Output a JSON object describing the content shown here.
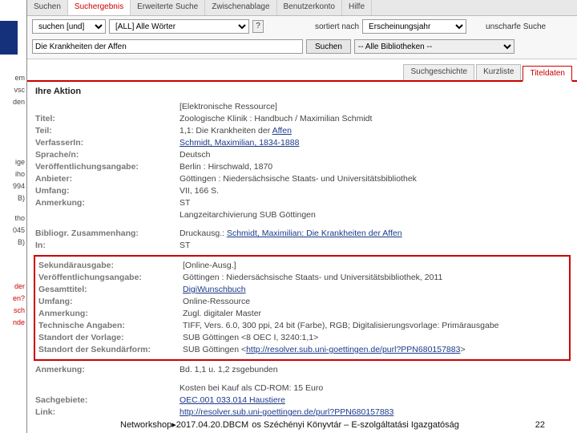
{
  "left": {
    "items": [
      "em",
      "vsc",
      "den",
      "",
      "ige",
      "iho",
      "994",
      "B)",
      "",
      "tho",
      "045",
      "B)"
    ],
    "red_items": [
      "der",
      "en?",
      "sch",
      "nde"
    ]
  },
  "topnav": {
    "tabs": [
      "Suchen",
      "Suchergebnis",
      "Erweiterte Suche",
      "Zwischenablage",
      "Benutzerkonto",
      "Hilfe"
    ],
    "active_index": 1
  },
  "search": {
    "mode": "suchen [und]",
    "field": "[ALL] Alle Wörter",
    "help": "?",
    "sort_label": "sortiert nach",
    "sort_value": "Erscheinungsjahr",
    "fuzzy_label": "unscharfe Suche",
    "query": "Die Krankheiten der Affen",
    "submit": "Suchen",
    "lib": "-- Alle Bibliotheken --"
  },
  "resulttabs": {
    "tabs": [
      "Suchgeschichte",
      "Kurzliste",
      "Titeldaten"
    ],
    "active_index": 2
  },
  "aktion_label": "Ihre Aktion",
  "block1": [
    {
      "label": "",
      "value": "[Elektronische Ressource]"
    },
    {
      "label": "Titel:",
      "value": "Zoologische Klinik : Handbuch / Maximilian Schmidt"
    },
    {
      "label": "Teil:",
      "value_html": "1,1: Die Krankheiten der <a href='#'>Affen</a>"
    },
    {
      "label": "VerfasserIn:",
      "value_html": "<a href='#'>Schmidt, Maximilian, 1834-1888</a>"
    },
    {
      "label": "Sprache/n:",
      "value": "Deutsch"
    },
    {
      "label": "Veröffentlichungsangabe:",
      "value": "Berlin : Hirschwald, 1870"
    },
    {
      "label": "Anbieter:",
      "value": "Göttingen : Niedersächsische Staats- und Universitätsbibliothek"
    },
    {
      "label": "Umfang:",
      "value": "VII, 166 S."
    },
    {
      "label": "Anmerkung:",
      "value": "ST"
    },
    {
      "label": "",
      "value": "Langzeitarchivierung SUB Göttingen"
    }
  ],
  "block2": [
    {
      "label": "Bibliogr. Zusammenhang:",
      "value_html": "Druckausg.: <a href='#'>Schmidt, Maximilian: Die Krankheiten der Affen</a>"
    },
    {
      "label": "In:",
      "value": "ST"
    }
  ],
  "redbox": [
    {
      "label": "Sekundärausgabe:",
      "value": "[Online-Ausg.]"
    },
    {
      "label": "Veröffentlichungsangabe:",
      "value": "Göttingen : Niedersächsische Staats- und Universitätsbibliothek, 2011"
    },
    {
      "label": "Gesamttitel:",
      "value_html": "<a href='#'>DigiWunschbuch</a>"
    },
    {
      "label": "Umfang:",
      "value": "Online-Ressource"
    },
    {
      "label": "Anmerkung:",
      "value": "Zugl. digitaler Master"
    },
    {
      "label": "Technische Angaben:",
      "value": "TIFF, Vers. 6.0, 300 ppi, 24 bit (Farbe), RGB; Digitalisierungsvorlage: Primärausgabe"
    },
    {
      "label": "Standort der Vorlage:",
      "value": "SUB Göttingen <8 OEC I, 3240:1,1>"
    },
    {
      "label": "Standort der Sekundärform:",
      "value_html": "SUB Göttingen <<a href='#'>http://resolver.sub.uni-goettingen.de/purl?PPN680157883</a>>"
    }
  ],
  "block3": [
    {
      "label": "Anmerkung:",
      "value": "Bd. 1,1 u. 1,2 zsgebunden"
    }
  ],
  "block4": [
    {
      "label": "",
      "value": "Kosten bei Kauf als CD-ROM: 15 Euro"
    },
    {
      "label": "Sachgebiete:",
      "value_html": "<a href='#'>OEC.001 033.014 Haustiere</a>"
    },
    {
      "label": "Link:",
      "value_html": "<a href='#'>http://resolver.sub.uni-goettingen.de/purl?PPN680157883</a>"
    }
  ],
  "footer": {
    "left": "Networkshop▸2017.04.20.DBCM",
    "center": "os Széchényi Könyvtár – E-szolgáltatási Igazgatóság",
    "page": "22"
  }
}
